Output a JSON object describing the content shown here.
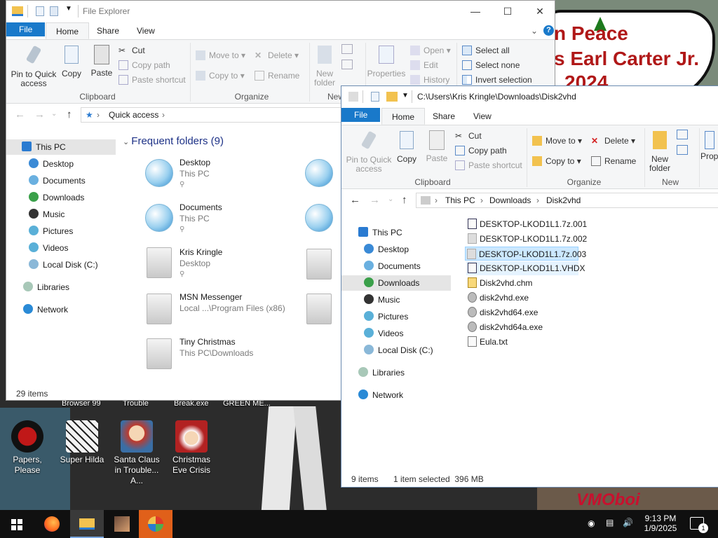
{
  "desktop": {
    "wallpaper_lines": [
      "n Peace",
      "s Earl Carter Jr.",
      "2024"
    ],
    "wallpaper_signature": "VMOboi",
    "top_labels": [
      "Browser 99",
      "Trouble",
      "Break.exe",
      "GREEN ME..."
    ],
    "icons": [
      {
        "label": "Papers, Please",
        "color": "#a01515"
      },
      {
        "label": "Super Hilda",
        "color": "#e8e8e8"
      },
      {
        "label": "Santa Claus in Trouble... A...",
        "color": "#c0392b"
      },
      {
        "label": "Christmas Eve Crisis",
        "color": "#b22222"
      }
    ]
  },
  "window1": {
    "title": "File Explorer",
    "tabs": [
      "File",
      "Home",
      "Share",
      "View"
    ],
    "ribbon": {
      "pin_label": "Pin to Quick access",
      "copy_label": "Copy",
      "paste_label": "Paste",
      "cut_label": "Cut",
      "copy_path_label": "Copy path",
      "paste_shortcut_label": "Paste shortcut",
      "clipboard_group": "Clipboard",
      "move_to_label": "Move to",
      "copy_to_label": "Copy to",
      "delete_label": "Delete",
      "rename_label": "Rename",
      "organize_group": "Organize",
      "new_folder_label": "New folder",
      "new_group": "New",
      "properties_label": "Properties",
      "open_label": "Open",
      "edit_label": "Edit",
      "history_label": "History",
      "select_all_label": "Select all",
      "select_none_label": "Select none",
      "invert_selection_label": "Invert selection"
    },
    "address": "Quick access",
    "section_title": "Frequent folders (9)",
    "nav": [
      "This PC",
      "Desktop",
      "Documents",
      "Downloads",
      "Music",
      "Pictures",
      "Videos",
      "Local Disk (C:)",
      "Libraries",
      "Network"
    ],
    "folders": [
      {
        "name": "Desktop",
        "location": "This PC"
      },
      {
        "name": "Documents",
        "location": "This PC"
      },
      {
        "name": "Kris Kringle",
        "location": "Desktop"
      },
      {
        "name": "MSN Messenger",
        "location": "Local ...\\Program Files (x86)"
      },
      {
        "name": "Tiny Christmas",
        "location": "This PC\\Downloads"
      }
    ],
    "status": "29 items"
  },
  "window2": {
    "title": "C:\\Users\\Kris Kringle\\Downloads\\Disk2vhd",
    "tabs": [
      "File",
      "Home",
      "Share",
      "View"
    ],
    "ribbon": {
      "pin_label": "Pin to Quick access",
      "copy_label": "Copy",
      "paste_label": "Paste",
      "cut_label": "Cut",
      "copy_path_label": "Copy path",
      "paste_shortcut_label": "Paste shortcut",
      "clipboard_group": "Clipboard",
      "move_to_label": "Move to",
      "copy_to_label": "Copy to",
      "delete_label": "Delete",
      "rename_label": "Rename",
      "organize_group": "Organize",
      "new_folder_label": "New folder",
      "new_group": "New",
      "properties_label": "Prop"
    },
    "breadcrumb": [
      "This PC",
      "Downloads",
      "Disk2vhd"
    ],
    "nav": [
      "This PC",
      "Desktop",
      "Documents",
      "Downloads",
      "Music",
      "Pictures",
      "Videos",
      "Local Disk (C:)",
      "Libraries",
      "Network"
    ],
    "files": [
      "DESKTOP-LKOD1L1.7z.001",
      "DESKTOP-LKOD1L1.7z.002",
      "DESKTOP-LKOD1L1.7z.003",
      "DESKTOP-LKOD1L1.VHDX",
      "Disk2vhd.chm",
      "disk2vhd.exe",
      "disk2vhd64.exe",
      "disk2vhd64a.exe",
      "Eula.txt"
    ],
    "status_items": "9 items",
    "status_selected": "1 item selected  396 MB"
  },
  "taskbar": {
    "time": "9:13 PM",
    "date": "1/9/2025",
    "notification_count": "1"
  }
}
